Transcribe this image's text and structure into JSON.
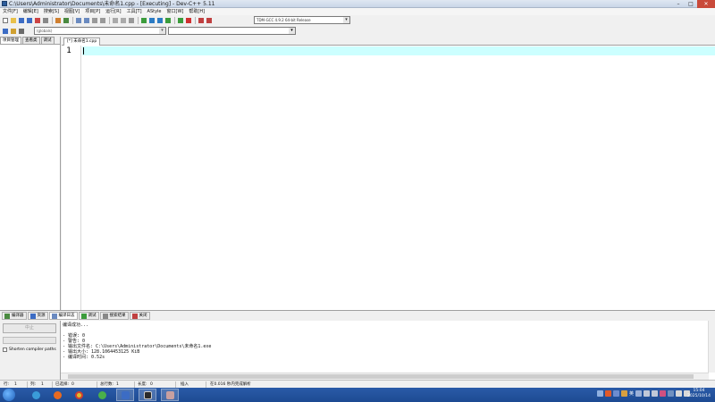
{
  "titlebar": {
    "title": "C:\\Users\\Administrator\\Documents\\未命名1.cpp - [Executing] - Dev-C++ 5.11",
    "buttons": {
      "min": "–",
      "max": "□",
      "close": "✕"
    }
  },
  "menu": [
    "文件[F]",
    "编辑[E]",
    "搜索[S]",
    "视图[V]",
    "项目[P]",
    "运行[R]",
    "工具[T]",
    "AStyle",
    "窗口[W]",
    "帮助[H]"
  ],
  "compiler": {
    "selected": "TDM-GCC 4.9.2 64-bit Release"
  },
  "class_browser": {
    "placeholder": "(globals)"
  },
  "left_panel": {
    "tabs": [
      "项目管理",
      "查看类",
      "调试"
    ]
  },
  "editor": {
    "tab": "[*] 未命名1.cpp",
    "line_numbers": [
      "1"
    ]
  },
  "bottom_tabs": [
    "编译器",
    "资源",
    "编译日志",
    "调试",
    "搜索结果",
    "关闭"
  ],
  "bottom_left": {
    "abort_label": "中止",
    "shorten_label": "Shorten compiler paths"
  },
  "log": {
    "lines": [
      "编译成功...",
      "",
      "- 错误: 0",
      "- 警告: 0",
      "- 输出文件名: C:\\Users\\Administrator\\Documents\\未命名1.exe",
      "- 输出大小: 128.1064453125 KiB",
      "- 编译时间: 0.52s"
    ]
  },
  "status": {
    "row": "行:",
    "row_val": "1",
    "col": "列:",
    "col_val": "1",
    "selected": "已选择:",
    "selected_val": "0",
    "total_lines": "总行数:",
    "total_lines_val": "1",
    "length": "长度:",
    "length_val": "0",
    "insert": "插入",
    "parse": "在0.016 秒内完成解析"
  },
  "taskbar": {
    "time": "15:04",
    "date": "2025/10/14",
    "ime": "英"
  },
  "colors": {
    "current_line": "#ccffff",
    "taskbar": "#1d4a92"
  }
}
